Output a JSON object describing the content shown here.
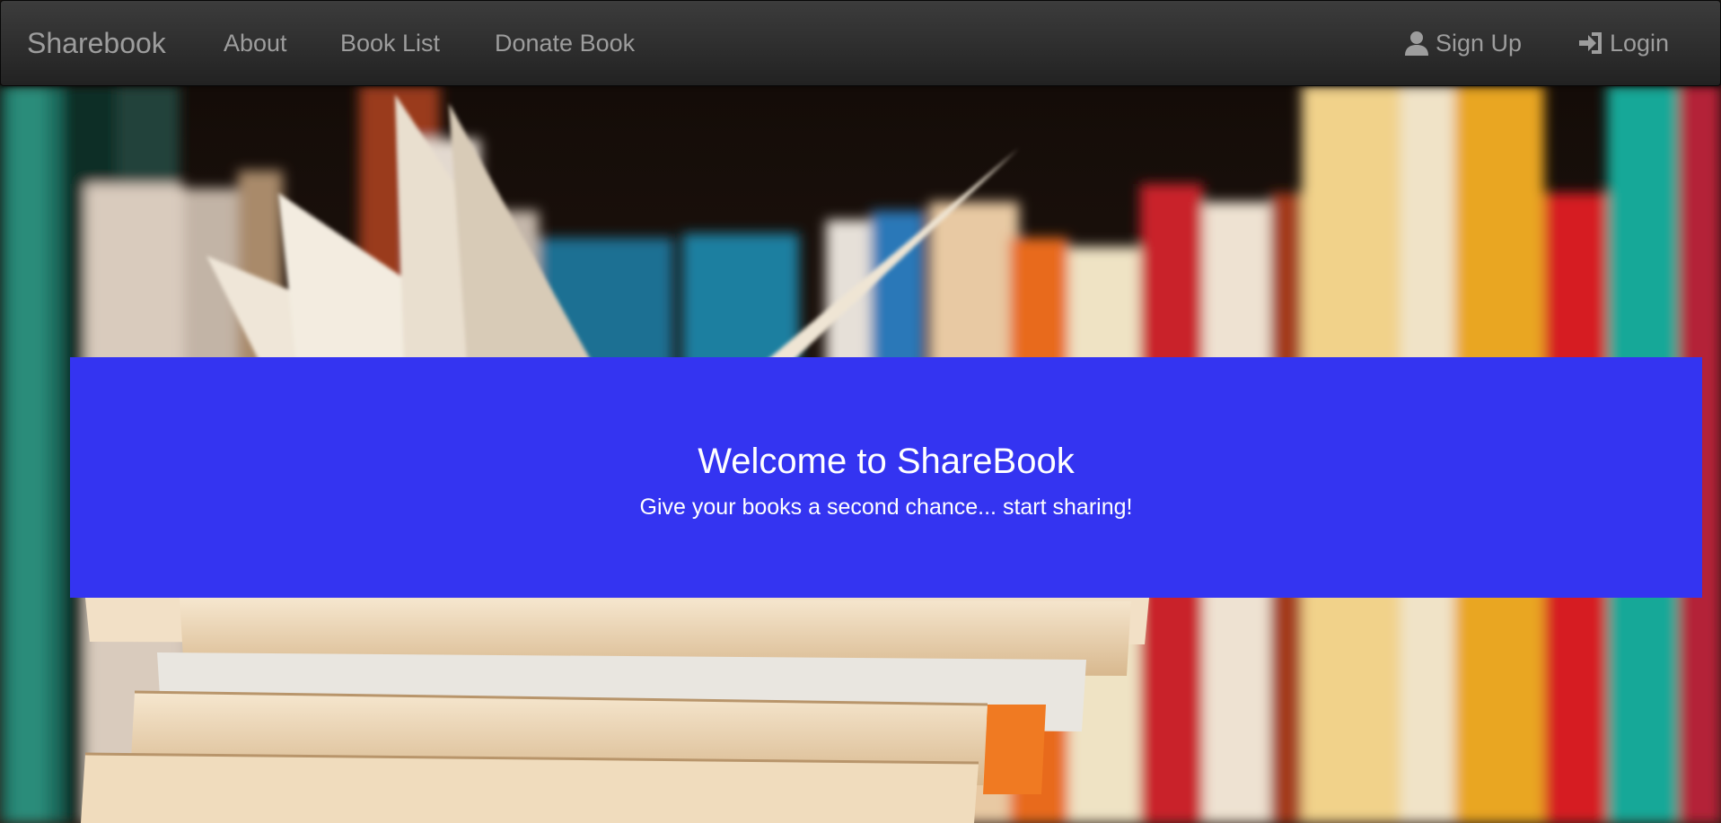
{
  "navbar": {
    "brand": "Sharebook",
    "links": [
      {
        "label": "About"
      },
      {
        "label": "Book List"
      },
      {
        "label": "Donate Book"
      }
    ],
    "right_links": [
      {
        "label": "Sign Up",
        "icon": "user-icon"
      },
      {
        "label": "Login",
        "icon": "login-icon"
      }
    ]
  },
  "jumbotron": {
    "title": "Welcome to ShareBook",
    "subtitle": "Give your books a second chance... start sharing!"
  },
  "colors": {
    "navbar_top": "#3c3c3c",
    "navbar_bottom": "#222222",
    "nav_text": "#9d9d9d",
    "jumbotron_bg": "#3434f1",
    "jumbotron_text": "#ffffff"
  }
}
